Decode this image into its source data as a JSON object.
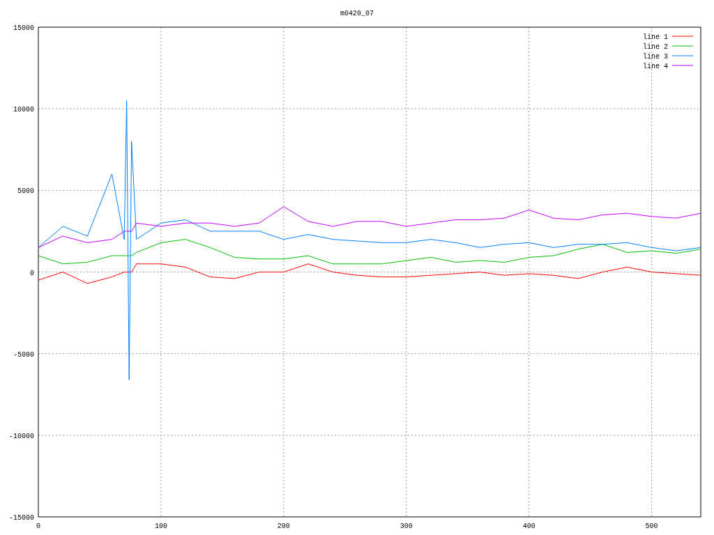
{
  "chart_data": {
    "type": "line",
    "title": "m0420_07",
    "x": [
      0,
      20,
      40,
      60,
      70,
      72,
      74,
      76,
      80,
      100,
      120,
      140,
      160,
      180,
      200,
      220,
      240,
      260,
      280,
      300,
      320,
      340,
      360,
      380,
      400,
      420,
      440,
      460,
      480,
      500,
      520,
      540
    ],
    "series": [
      {
        "name": "line 1",
        "color": "#ff0000",
        "values": [
          -500,
          0,
          -700,
          -300,
          0,
          0,
          0,
          0,
          500,
          500,
          300,
          -300,
          -400,
          0,
          0,
          500,
          0,
          -200,
          -300,
          -300,
          -200,
          -100,
          0,
          -200,
          -100,
          -200,
          -400,
          0,
          300,
          0,
          -100,
          -200
        ]
      },
      {
        "name": "line 2",
        "color": "#00c000",
        "values": [
          1000,
          500,
          600,
          1000,
          1000,
          1000,
          1000,
          1000,
          1200,
          1800,
          2000,
          1500,
          900,
          800,
          800,
          1000,
          500,
          500,
          500,
          700,
          900,
          600,
          700,
          600,
          900,
          1000,
          1400,
          1700,
          1200,
          1300,
          1150,
          1400
        ]
      },
      {
        "name": "line 3",
        "color": "#0080ff",
        "values": [
          1500,
          2800,
          2200,
          6000,
          2000,
          10500,
          -6600,
          8000,
          2000,
          3000,
          3200,
          2500,
          2500,
          2500,
          2000,
          2300,
          2000,
          1900,
          1800,
          1800,
          2000,
          1800,
          1500,
          1700,
          1800,
          1500,
          1700,
          1700,
          1800,
          1500,
          1300,
          1500
        ]
      },
      {
        "name": "line 4",
        "color": "#c000ff",
        "values": [
          1500,
          2200,
          1800,
          2000,
          2500,
          2500,
          2500,
          2500,
          3000,
          2800,
          3000,
          3000,
          2800,
          3000,
          4000,
          3100,
          2800,
          3100,
          3100,
          2800,
          3000,
          3200,
          3200,
          3300,
          3800,
          3300,
          3200,
          3500,
          3600,
          3400,
          3300,
          3600
        ]
      }
    ],
    "xlim": [
      0,
      540
    ],
    "ylim": [
      -15000,
      15000
    ],
    "xticks": [
      0,
      100,
      200,
      300,
      400,
      500
    ],
    "yticks": [
      -15000,
      -10000,
      -5000,
      0,
      5000,
      10000,
      15000
    ],
    "grid": true,
    "legend": true
  }
}
